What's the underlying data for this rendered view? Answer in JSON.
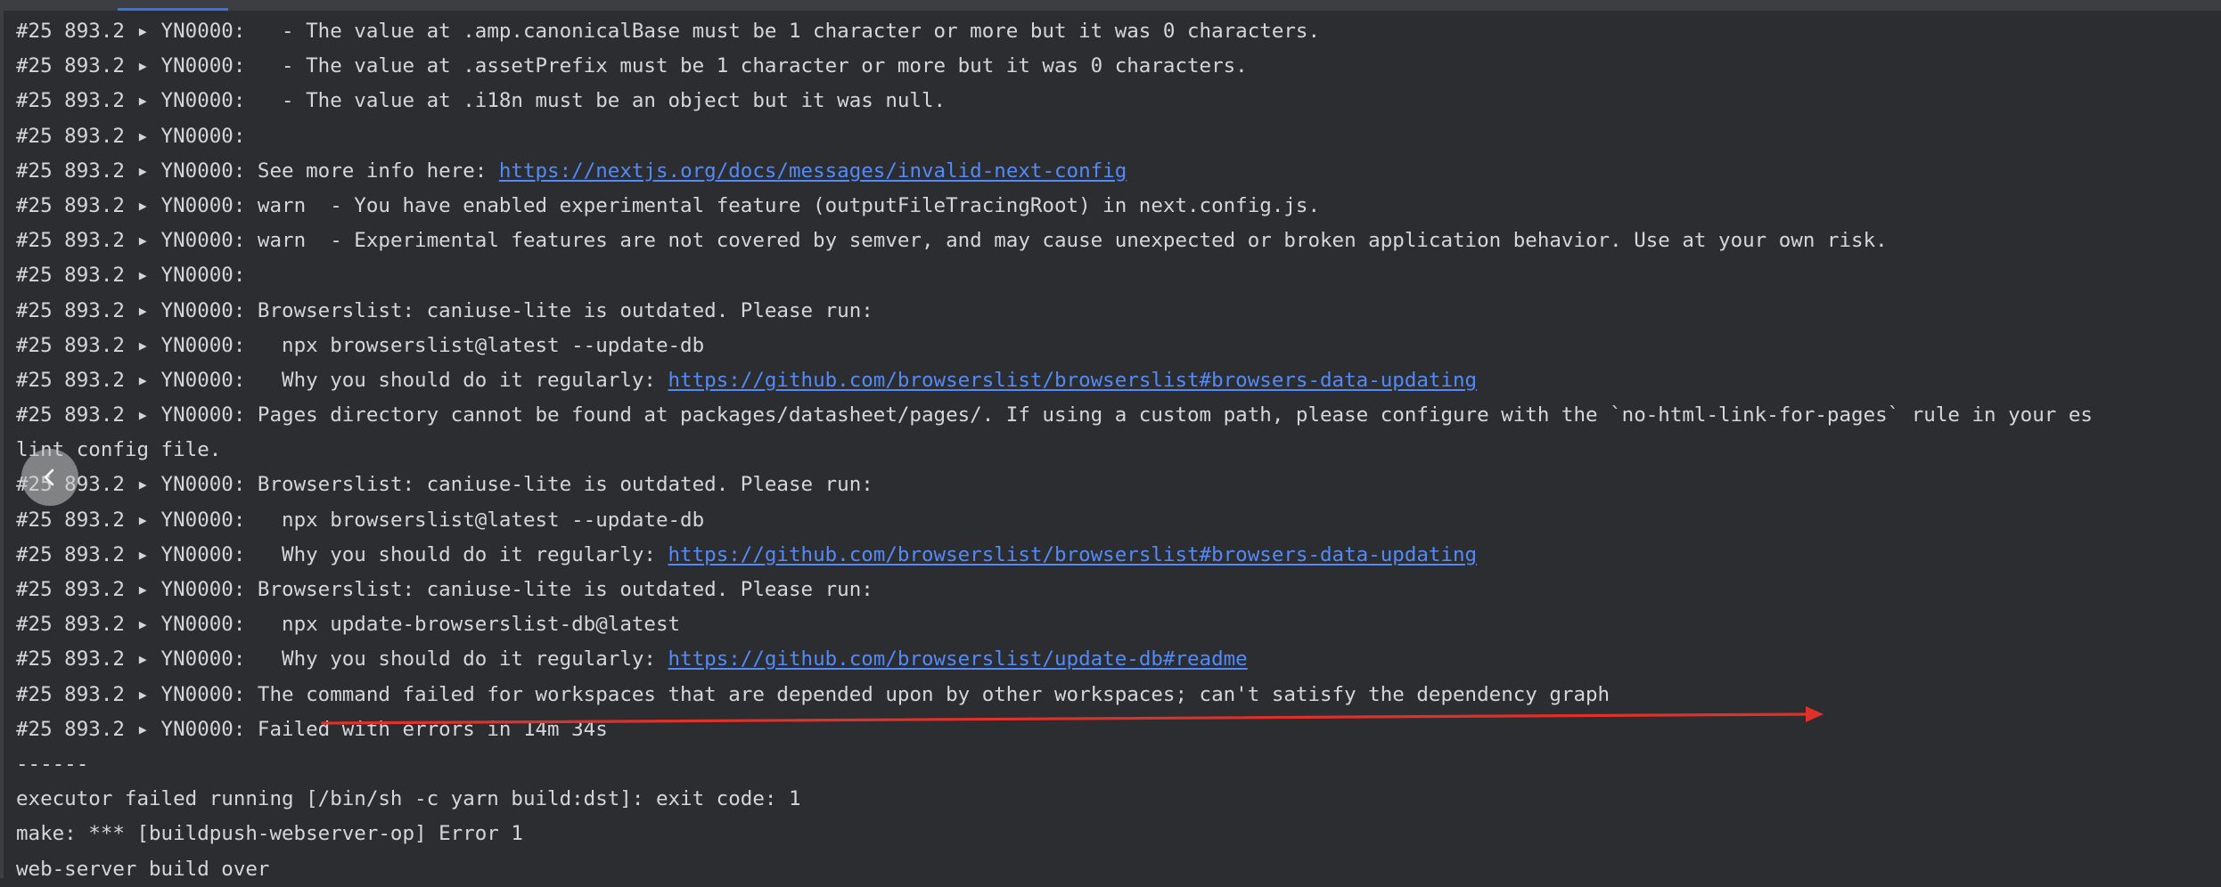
{
  "console": {
    "lines": [
      {
        "prefix": "#25 893.2 ▸ YN0000:",
        "text": "   - The value at .amp.canonicalBase must be 1 character or more but it was 0 characters."
      },
      {
        "prefix": "#25 893.2 ▸ YN0000:",
        "text": "   - The value at .assetPrefix must be 1 character or more but it was 0 characters."
      },
      {
        "prefix": "#25 893.2 ▸ YN0000:",
        "text": "   - The value at .i18n must be an object but it was null."
      },
      {
        "prefix": "#25 893.2 ▸ YN0000:",
        "text": ""
      },
      {
        "prefix": "#25 893.2 ▸ YN0000:",
        "text": " See more info here: ",
        "link": "https://nextjs.org/docs/messages/invalid-next-config"
      },
      {
        "prefix": "#25 893.2 ▸ YN0000:",
        "text": " warn  - You have enabled experimental feature (outputFileTracingRoot) in next.config.js."
      },
      {
        "prefix": "#25 893.2 ▸ YN0000:",
        "text": " warn  - Experimental features are not covered by semver, and may cause unexpected or broken application behavior. Use at your own risk."
      },
      {
        "prefix": "#25 893.2 ▸ YN0000:",
        "text": ""
      },
      {
        "prefix": "#25 893.2 ▸ YN0000:",
        "text": " Browserslist: caniuse-lite is outdated. Please run:"
      },
      {
        "prefix": "#25 893.2 ▸ YN0000:",
        "text": "   npx browserslist@latest --update-db"
      },
      {
        "prefix": "#25 893.2 ▸ YN0000:",
        "text": "   Why you should do it regularly: ",
        "link": "https://github.com/browserslist/browserslist#browsers-data-updating"
      },
      {
        "prefix": "#25 893.2 ▸ YN0000:",
        "text": " Pages directory cannot be found at packages/datasheet/pages/. If using a custom path, please configure with the `no-html-link-for-pages` rule in your es"
      },
      {
        "prefix": "",
        "text": "lint config file."
      },
      {
        "prefix": "#25 893.2 ▸ YN0000:",
        "text": " Browserslist: caniuse-lite is outdated. Please run:"
      },
      {
        "prefix": "#25 893.2 ▸ YN0000:",
        "text": "   npx browserslist@latest --update-db"
      },
      {
        "prefix": "#25 893.2 ▸ YN0000:",
        "text": "   Why you should do it regularly: ",
        "link": "https://github.com/browserslist/browserslist#browsers-data-updating"
      },
      {
        "prefix": "#25 893.2 ▸ YN0000:",
        "text": " Browserslist: caniuse-lite is outdated. Please run:"
      },
      {
        "prefix": "#25 893.2 ▸ YN0000:",
        "text": "   npx update-browserslist-db@latest"
      },
      {
        "prefix": "#25 893.2 ▸ YN0000:",
        "text": "   Why you should do it regularly: ",
        "link": "https://github.com/browserslist/update-db#readme"
      },
      {
        "prefix": "#25 893.2 ▸ YN0000:",
        "text": " The command failed for workspaces that are depended upon by other workspaces; can't satisfy the dependency graph"
      },
      {
        "prefix": "#25 893.2 ▸ YN0000:",
        "text": " Failed with errors in 14m 34s"
      },
      {
        "prefix": "",
        "text": "------"
      },
      {
        "prefix": "",
        "text": "executor failed running [/bin/sh -c yarn build:dst]: exit code: 1"
      },
      {
        "prefix": "",
        "text": "make: *** [buildpush-webserver-op] Error 1"
      },
      {
        "prefix": "",
        "text": "web-server build over"
      }
    ]
  },
  "annotation": {
    "color": "#e0302a"
  },
  "icons": {
    "collapse": "chevron-left-icon"
  },
  "colors": {
    "background": "#2b2d30",
    "text": "#d4d6db",
    "link": "#548af7"
  }
}
